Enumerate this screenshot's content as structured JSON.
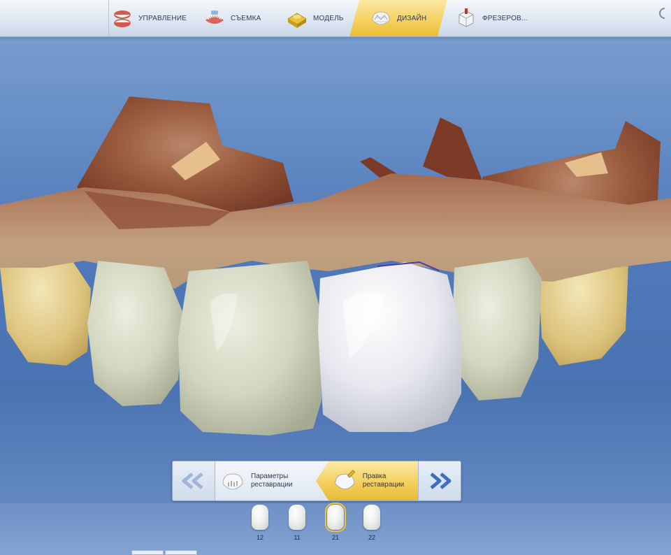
{
  "phases": [
    {
      "label": "УПРАВЛЕНИЕ",
      "icon": "jaw-models-icon",
      "active": false
    },
    {
      "label": "СЪЕМКА",
      "icon": "scan-jaw-icon",
      "active": false
    },
    {
      "label": "МОДЕЛЬ",
      "icon": "model-base-icon",
      "active": false
    },
    {
      "label": "ДИЗАЙН",
      "icon": "crown-design-icon",
      "active": true
    },
    {
      "label": "ФРЕЗЕРОВ...",
      "icon": "milling-block-icon",
      "active": false
    }
  ],
  "steps": {
    "prev_icon": "double-chevron-left-icon",
    "next_icon": "double-chevron-right-icon",
    "items": [
      {
        "label": "Параметры реставрации",
        "icon": "restoration-params-icon",
        "active": false
      },
      {
        "label": "Правка реставрации",
        "icon": "restoration-edit-icon",
        "active": true
      }
    ]
  },
  "teeth": [
    {
      "number": "12",
      "selected": false
    },
    {
      "number": "11",
      "selected": false
    },
    {
      "number": "21",
      "selected": true
    },
    {
      "number": "22",
      "selected": false
    }
  ],
  "colors": {
    "active_tab": "#f3cd58",
    "viewport_bg": "#4f79b9",
    "tissue": "#8a4a33",
    "tooth": "#d9dbc8",
    "restoration": "#e9eaee"
  }
}
